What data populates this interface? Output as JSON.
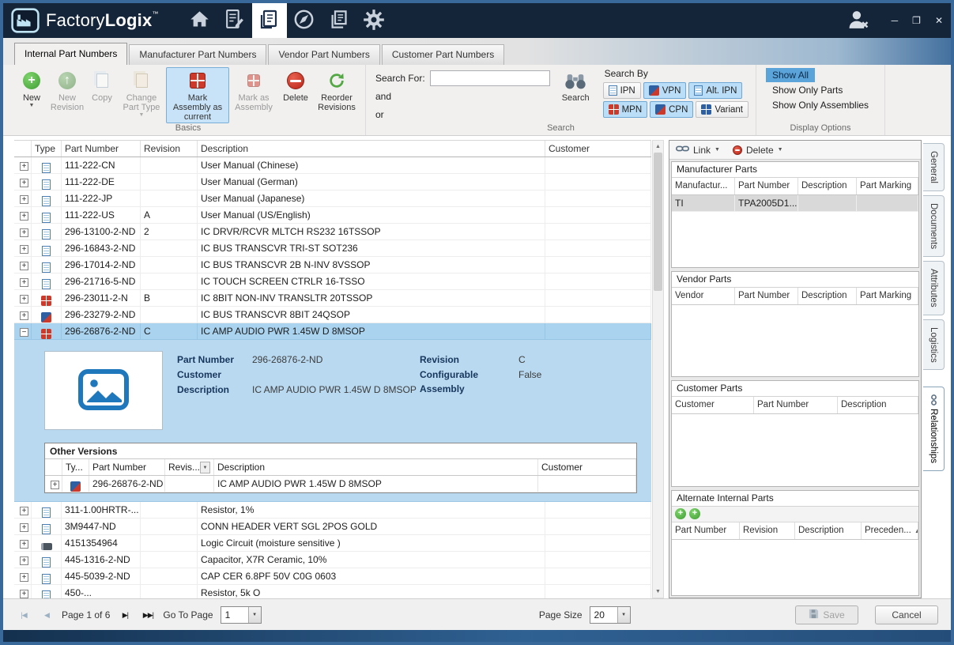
{
  "titlebar": {
    "brand_factory": "Factory",
    "brand_logix": "Logix",
    "trademark": "™",
    "window_controls": {
      "minimize": "─",
      "maximize": "❐",
      "close": "✕"
    }
  },
  "tabs": [
    "Internal Part Numbers",
    "Manufacturer Part Numbers",
    "Vendor Part Numbers",
    "Customer Part Numbers"
  ],
  "ribbon": {
    "basics": {
      "group_label": "Basics",
      "new": "New",
      "new_revision": "New Revision",
      "copy": "Copy",
      "change_part_type": "Change Part Type",
      "mark_assembly_as_current": "Mark Assembly as current",
      "mark_as_assembly": "Mark as Assembly",
      "delete": "Delete",
      "reorder_revisions": "Reorder Revisions"
    },
    "search": {
      "group_label": "Search",
      "search_for_label": "Search For:",
      "search_value": "",
      "and_label": "and",
      "or_label": "or",
      "search_button_label": "Search",
      "search_by_label": "Search By",
      "filters": [
        "IPN",
        "VPN",
        "Alt. IPN",
        "MPN",
        "CPN",
        "Variant"
      ]
    },
    "display": {
      "group_label": "Display Options",
      "options": [
        "Show All",
        "Show Only Parts",
        "Show Only Assemblies"
      ]
    }
  },
  "main_table": {
    "columns": [
      "",
      "Type",
      "Part Number",
      "Revision",
      "Description",
      "Customer"
    ],
    "rows": [
      {
        "expander": "+",
        "type_icon": "doc",
        "part_number": "111-222-CN",
        "revision": "",
        "description": "User Manual (Chinese)",
        "customer": ""
      },
      {
        "expander": "+",
        "type_icon": "doc",
        "part_number": "111-222-DE",
        "revision": "",
        "description": "User Manual (German)",
        "customer": ""
      },
      {
        "expander": "+",
        "type_icon": "doc",
        "part_number": "111-222-JP",
        "revision": "",
        "description": "User Manual (Japanese)",
        "customer": ""
      },
      {
        "expander": "+",
        "type_icon": "doc",
        "part_number": "111-222-US",
        "revision": "A",
        "description": "User Manual (US/English)",
        "customer": ""
      },
      {
        "expander": "+",
        "type_icon": "doc",
        "part_number": "296-13100-2-ND",
        "revision": "2",
        "description": "IC DRVR/RCVR MLTCH RS232 16TSSOP",
        "customer": ""
      },
      {
        "expander": "+",
        "type_icon": "doc",
        "part_number": "296-16843-2-ND",
        "revision": "",
        "description": "IC BUS TRANSCVR TRI-ST SOT236",
        "customer": ""
      },
      {
        "expander": "+",
        "type_icon": "doc",
        "part_number": "296-17014-2-ND",
        "revision": "",
        "description": "IC BUS TRANSCVR 2B N-INV 8VSSOP",
        "customer": ""
      },
      {
        "expander": "+",
        "type_icon": "doc",
        "part_number": "296-21716-5-ND",
        "revision": "",
        "description": "IC TOUCH SCREEN CTRLR 16-TSSO",
        "customer": ""
      },
      {
        "expander": "+",
        "type_icon": "asm",
        "part_number": "296-23011-2-N",
        "revision": "B",
        "description": "IC 8BIT NON-INV TRANSLTR 20TSSOP",
        "customer": ""
      },
      {
        "expander": "+",
        "type_icon": "asm2",
        "part_number": "296-23279-2-ND",
        "revision": "",
        "description": "IC BUS TRANSCVR 8BIT 24QSOP",
        "customer": ""
      },
      {
        "expander": "−",
        "type_icon": "asm",
        "part_number": "296-26876-2-ND",
        "revision": "C",
        "description": "IC AMP AUDIO PWR 1.45W D 8MSOP",
        "customer": "",
        "selected": true,
        "expanded": true
      },
      {
        "expander": "+",
        "type_icon": "doc",
        "part_number": "311-1.00HRTR-...",
        "revision": "",
        "description": "Resistor, 1%",
        "customer": ""
      },
      {
        "expander": "+",
        "type_icon": "doc",
        "part_number": "3M9447-ND",
        "revision": "",
        "description": "CONN HEADER VERT SGL 2POS GOLD",
        "customer": ""
      },
      {
        "expander": "+",
        "type_icon": "chip",
        "part_number": "4151354964",
        "revision": "",
        "description": "Logic Circuit (moisture sensitive )",
        "customer": ""
      },
      {
        "expander": "+",
        "type_icon": "doc",
        "part_number": "445-1316-2-ND",
        "revision": "",
        "description": "Capacitor,  X7R Ceramic, 10%",
        "customer": ""
      },
      {
        "expander": "+",
        "type_icon": "doc",
        "part_number": "445-5039-2-ND",
        "revision": "",
        "description": "CAP CER 6.8PF 50V C0G 0603",
        "customer": ""
      },
      {
        "expander": "+",
        "type_icon": "doc",
        "part_number": "450-...",
        "revision": "",
        "description": "Resistor, 5k O",
        "customer": ""
      }
    ]
  },
  "detail_panel": {
    "part_number_label": "Part Number",
    "part_number": "296-26876-2-ND",
    "customer_label": "Customer",
    "customer": "",
    "description_label": "Description",
    "description": "IC AMP AUDIO PWR 1.45W D 8MSOP",
    "revision_label": "Revision",
    "revision": "C",
    "configurable_label": "Configurable Assembly",
    "configurable": "False",
    "other_versions": {
      "title": "Other Versions",
      "columns": [
        "Ty...",
        "Part Number",
        "Revis...",
        "Description",
        "Customer"
      ],
      "rows": [
        {
          "expander": "+",
          "type_icon": "asm2",
          "part_number": "296-26876-2-ND",
          "revision": "",
          "description": "IC AMP AUDIO PWR 1.45W D 8MSOP",
          "customer": ""
        }
      ]
    }
  },
  "right_panel": {
    "link_button": "Link",
    "delete_button": "Delete",
    "sections": [
      {
        "title": "Manufacturer Parts",
        "columns": [
          "Manufactur...",
          "Part Number",
          "Description",
          "Part Marking"
        ],
        "rows": [
          [
            "TI",
            "TPA2005D1...",
            "",
            ""
          ]
        ],
        "selected_row": 0
      },
      {
        "title": "Vendor Parts",
        "columns": [
          "Vendor",
          "Part Number",
          "Description",
          "Part Marking"
        ],
        "rows": []
      },
      {
        "title": "Customer Parts",
        "columns": [
          "Customer",
          "Part Number",
          "Description"
        ],
        "rows": []
      },
      {
        "title": "Alternate Internal Parts",
        "columns": [
          "Part Number",
          "Revision",
          "Description",
          "Preceden..."
        ],
        "rows": [],
        "sort_col": 3,
        "sort_glyph": "▲",
        "has_toolbar": true
      }
    ]
  },
  "side_tabs": [
    "General",
    "Documents",
    "Attributes",
    "Logistics",
    "Relationships"
  ],
  "pagination": {
    "page_label": "Page 1 of 6",
    "go_to_page_label": "Go To Page",
    "go_to_page_value": "1",
    "page_size_label": "Page Size",
    "page_size_value": "20",
    "save_label": "Save",
    "cancel_label": "Cancel"
  },
  "icons": {
    "first_page": "|◀",
    "previous_page": "◀",
    "next_page": "▶|",
    "last_page": "▶▶|",
    "dropdown": "▼",
    "scroll_up": "▲",
    "scroll_down": "▼"
  }
}
